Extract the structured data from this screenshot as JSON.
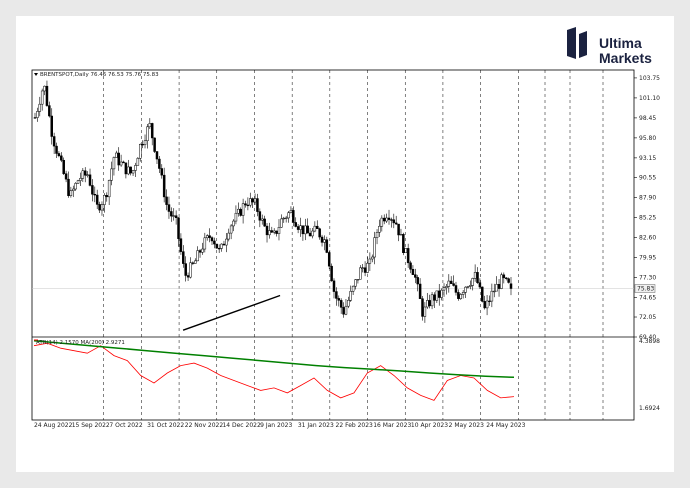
{
  "brand": {
    "line1": "Ultima",
    "line2": "Markets",
    "logo_icon": "ultima-markets-logo-icon"
  },
  "header": {
    "symbol_text": "BRENTSPOT,Daily  76.46 76.53 75.76 75.83"
  },
  "indicator_header": {
    "text": "ATR(14) 2.1570   MA(200) 2.9271"
  },
  "colors": {
    "candles": "#000000",
    "atr": "#ff0000",
    "ma": "#008000",
    "trendline": "#000000",
    "grid": "#000000"
  },
  "chart_data": [
    {
      "type": "candlestick",
      "title": "BRENTSPOT,Daily",
      "ohlc_last": {
        "open": 76.46,
        "high": 76.53,
        "low": 75.76,
        "close": 75.83
      },
      "ylim": [
        69.4,
        104.8
      ],
      "y_ticks": [
        "103.75",
        "101.10",
        "98.45",
        "95.80",
        "93.15",
        "90.55",
        "87.90",
        "85.25",
        "82.60",
        "79.95",
        "77.30",
        "74.65",
        "72.05",
        "69.40"
      ],
      "current_price_label": "75.83",
      "x_ticks": [
        "24 Aug 2022",
        "15 Sep 2022",
        "7 Oct 2022",
        "31 Oct 2022",
        "22 Nov 2022",
        "14 Dec 2022",
        "9 Jan 2023",
        "31 Jan 2023",
        "22 Feb 2023",
        "16 Mar 2023",
        "10 Apr 2023",
        "2 May 2023",
        "24 May 2023"
      ],
      "close_path": [
        [
          0,
          98.5
        ],
        [
          1,
          103.0
        ],
        [
          2,
          96.0
        ],
        [
          3,
          92.0
        ],
        [
          4,
          88.0
        ],
        [
          5,
          90.5
        ],
        [
          6,
          91.0
        ],
        [
          7,
          86.5
        ],
        [
          8,
          88.0
        ],
        [
          9,
          93.5
        ],
        [
          10,
          92.0
        ],
        [
          11,
          91.0
        ],
        [
          12,
          95.0
        ],
        [
          13,
          97.5
        ],
        [
          14,
          92.5
        ],
        [
          15,
          86.5
        ],
        [
          16,
          84.5
        ],
        [
          17,
          77.5
        ],
        [
          18,
          79.0
        ],
        [
          19,
          81.5
        ],
        [
          20,
          83.0
        ],
        [
          21,
          80.5
        ],
        [
          22,
          84.0
        ],
        [
          23,
          85.5
        ],
        [
          24,
          87.5
        ],
        [
          25,
          87.0
        ],
        [
          26,
          84.0
        ],
        [
          27,
          82.5
        ],
        [
          28,
          85.0
        ],
        [
          29,
          86.0
        ],
        [
          30,
          84.0
        ],
        [
          31,
          83.0
        ],
        [
          32,
          83.5
        ],
        [
          33,
          82.0
        ],
        [
          34,
          75.0
        ],
        [
          35,
          72.8
        ],
        [
          36,
          75.5
        ],
        [
          37,
          78.5
        ],
        [
          38,
          79.0
        ],
        [
          39,
          84.5
        ],
        [
          40,
          86.0
        ],
        [
          41,
          84.5
        ],
        [
          42,
          80.5
        ],
        [
          43,
          78.0
        ],
        [
          44,
          72.5
        ],
        [
          45,
          74.5
        ],
        [
          46,
          75.0
        ],
        [
          47,
          76.5
        ],
        [
          48,
          75.0
        ],
        [
          49,
          76.5
        ],
        [
          50,
          77.5
        ],
        [
          51,
          73.0
        ],
        [
          52,
          75.5
        ],
        [
          53,
          77.0
        ],
        [
          54,
          75.83
        ]
      ],
      "trendline": {
        "start": {
          "x": 16.8,
          "y": 70.3
        },
        "end": {
          "x": 27.8,
          "y": 74.9
        }
      }
    },
    {
      "type": "line",
      "series": [
        {
          "name": "ATR(14)",
          "last_value": 2.157,
          "values": [
            4.2,
            4.3,
            4.1,
            4.0,
            3.9,
            4.2,
            3.8,
            3.6,
            3.0,
            2.7,
            3.1,
            3.4,
            3.5,
            3.3,
            3.0,
            2.8,
            2.6,
            2.4,
            2.5,
            2.3,
            2.6,
            2.9,
            2.4,
            2.1,
            2.3,
            3.1,
            3.4,
            3.0,
            2.5,
            2.2,
            2.0,
            2.8,
            3.0,
            2.9,
            2.4,
            2.1,
            2.15
          ]
        },
        {
          "name": "MA(200)",
          "last_value": 2.9271,
          "values": [
            4.4,
            4.3,
            4.2,
            4.1,
            4.0,
            3.9,
            3.8,
            3.7,
            3.6,
            3.5,
            3.4,
            3.32,
            3.25,
            3.18,
            3.1,
            3.03,
            2.97,
            2.93
          ]
        }
      ],
      "ylim": [
        1.6924,
        4.3898
      ],
      "y_ticks": [
        "4.3898",
        "1.6924"
      ]
    }
  ]
}
